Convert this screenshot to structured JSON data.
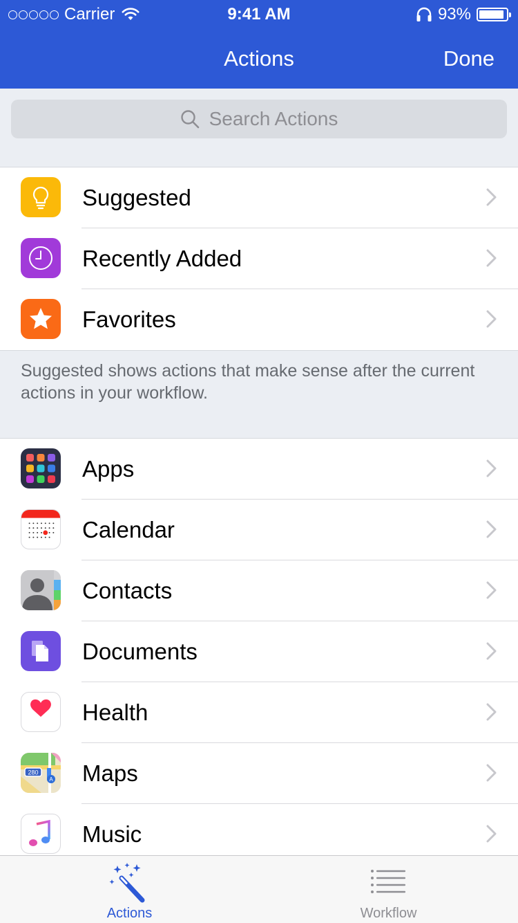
{
  "status_bar": {
    "carrier": "Carrier",
    "time": "9:41 AM",
    "battery_pct_text": "93%",
    "battery_level": 0.93
  },
  "nav": {
    "title": "Actions",
    "done_label": "Done"
  },
  "search": {
    "placeholder": "Search Actions"
  },
  "top_section": {
    "items": [
      {
        "label": "Suggested",
        "icon": "lightbulb-icon",
        "color": "#fbb909"
      },
      {
        "label": "Recently Added",
        "icon": "clock-icon",
        "color": "#a13ad9"
      },
      {
        "label": "Favorites",
        "icon": "star-icon",
        "color": "#fa6a16"
      }
    ],
    "footer": "Suggested shows actions that make sense after the current actions in your workflow."
  },
  "categories": {
    "items": [
      {
        "label": "Apps",
        "icon": "apps-icon"
      },
      {
        "label": "Calendar",
        "icon": "calendar-icon"
      },
      {
        "label": "Contacts",
        "icon": "contacts-icon"
      },
      {
        "label": "Documents",
        "icon": "documents-icon"
      },
      {
        "label": "Health",
        "icon": "health-icon"
      },
      {
        "label": "Maps",
        "icon": "maps-icon"
      },
      {
        "label": "Music",
        "icon": "music-icon"
      }
    ]
  },
  "maps_icon_text": "280",
  "tab_bar": {
    "tabs": [
      {
        "label": "Actions",
        "icon": "magic-wand-icon",
        "active": true
      },
      {
        "label": "Workflow",
        "icon": "list-icon",
        "active": false
      }
    ]
  },
  "colors": {
    "accent": "#2d59d6",
    "background": "#ebeef3"
  }
}
